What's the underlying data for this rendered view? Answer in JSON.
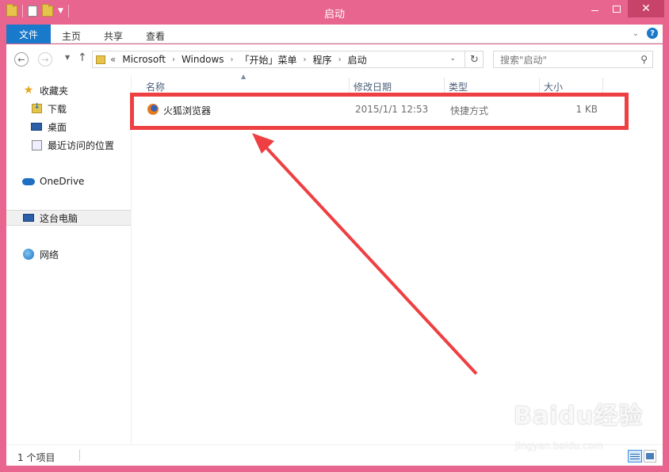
{
  "window": {
    "title": "启动",
    "colors": {
      "frame": "#e8658f",
      "file_tab": "#1979ca",
      "highlight": "#ee3f42"
    }
  },
  "ribbon": {
    "file_tab": "文件",
    "tabs": [
      "主页",
      "共享",
      "查看"
    ]
  },
  "address": {
    "overflow": "«",
    "crumbs": [
      "Microsoft",
      "Windows",
      "「开始」菜单",
      "程序",
      "启动"
    ]
  },
  "search": {
    "placeholder": "搜索\"启动\""
  },
  "sidebar": {
    "items": [
      {
        "label": "收藏夹",
        "icon": "star-icon"
      },
      {
        "label": "下载",
        "icon": "downloads-folder-icon"
      },
      {
        "label": "桌面",
        "icon": "desktop-icon"
      },
      {
        "label": "最近访问的位置",
        "icon": "recent-places-icon"
      },
      {
        "label": "OneDrive",
        "icon": "cloud-icon"
      },
      {
        "label": "这台电脑",
        "icon": "computer-icon"
      },
      {
        "label": "网络",
        "icon": "network-icon"
      }
    ]
  },
  "columns": {
    "name": "名称",
    "date": "修改日期",
    "type": "类型",
    "size": "大小"
  },
  "files": [
    {
      "name": "火狐浏览器",
      "date": "2015/1/1 12:53",
      "type": "快捷方式",
      "size": "1 KB",
      "icon": "firefox-icon"
    }
  ],
  "status": {
    "count": "1 个项目"
  },
  "watermark": {
    "brand": "Baidu经验",
    "url": "jingyan.baidu.com"
  }
}
